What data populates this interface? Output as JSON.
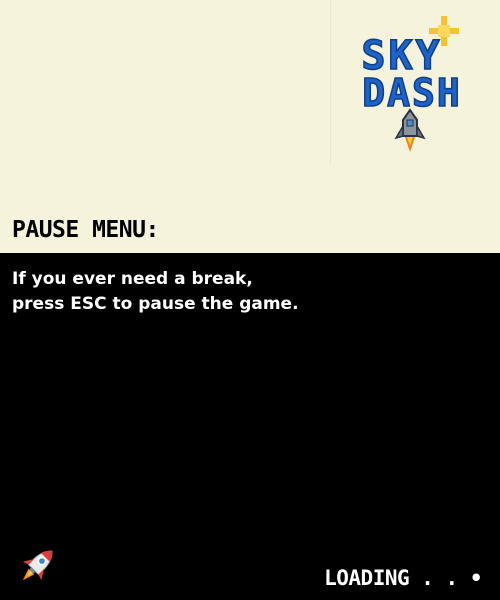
{
  "logo": {
    "line1": "SKY",
    "line2": "DASH",
    "color": "#1e63c8",
    "star_color": "#f4c430"
  },
  "pause_section": {
    "heading": "PAUSE MENU:"
  },
  "tip": {
    "line1": "If you ever need a break,",
    "line2": "press ESC to pause the game."
  },
  "loading": {
    "label": "LOADING . . •"
  },
  "icons": {
    "logo_rocket": "rocket-icon",
    "loading_rocket": "rocket-icon",
    "star": "sparkle-star-icon"
  },
  "colors": {
    "top_background": "#f5f3dc",
    "bottom_background": "#000000",
    "text_dark": "#000000",
    "text_light": "#ffffff"
  }
}
